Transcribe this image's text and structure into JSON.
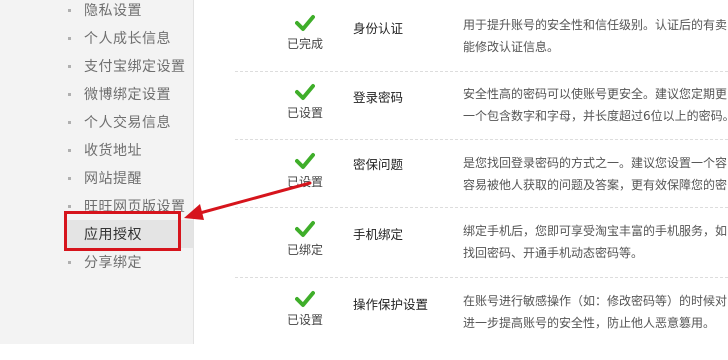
{
  "sidebar": {
    "items": [
      {
        "label": "隐私设置"
      },
      {
        "label": "个人成长信息"
      },
      {
        "label": "支付宝绑定设置"
      },
      {
        "label": "微博绑定设置"
      },
      {
        "label": "个人交易信息"
      },
      {
        "label": "收货地址"
      },
      {
        "label": "网站提醒"
      },
      {
        "label": "旺旺网页版设置"
      },
      {
        "label": "应用授权",
        "active": true
      },
      {
        "label": "分享绑定"
      }
    ]
  },
  "security": {
    "rows": [
      {
        "status": "已完成",
        "name": "身份认证",
        "desc": [
          "用于提升账号的安全性和信任级别。认证后的有卖",
          "能修改认证信息。"
        ]
      },
      {
        "status": "已设置",
        "name": "登录密码",
        "desc": [
          "安全性高的密码可以使账号更安全。建议您定期更",
          "一个包含数字和字母，并长度超过6位以上的密码。"
        ]
      },
      {
        "status": "已设置",
        "name": "密保问题",
        "desc": [
          "是您找回登录密码的方式之一。建议您设置一个容",
          "容易被他人获取的问题及答案，更有效保障您的密"
        ]
      },
      {
        "status": "已绑定",
        "name": "手机绑定",
        "desc": [
          "绑定手机后，您即可享受淘宝丰富的手机服务，如",
          "找回密码、开通手机动态密码等。"
        ]
      },
      {
        "status": "已设置",
        "name": "操作保护设置",
        "desc": [
          "在账号进行敏感操作（如：修改密码等）的时候对",
          "进一步提高账号的安全性，防止他人恶意篡用。"
        ]
      }
    ]
  },
  "colors": {
    "check": "#3fae2a",
    "highlight": "#d6141c",
    "sidebar_bg": "#f3f3f3"
  }
}
